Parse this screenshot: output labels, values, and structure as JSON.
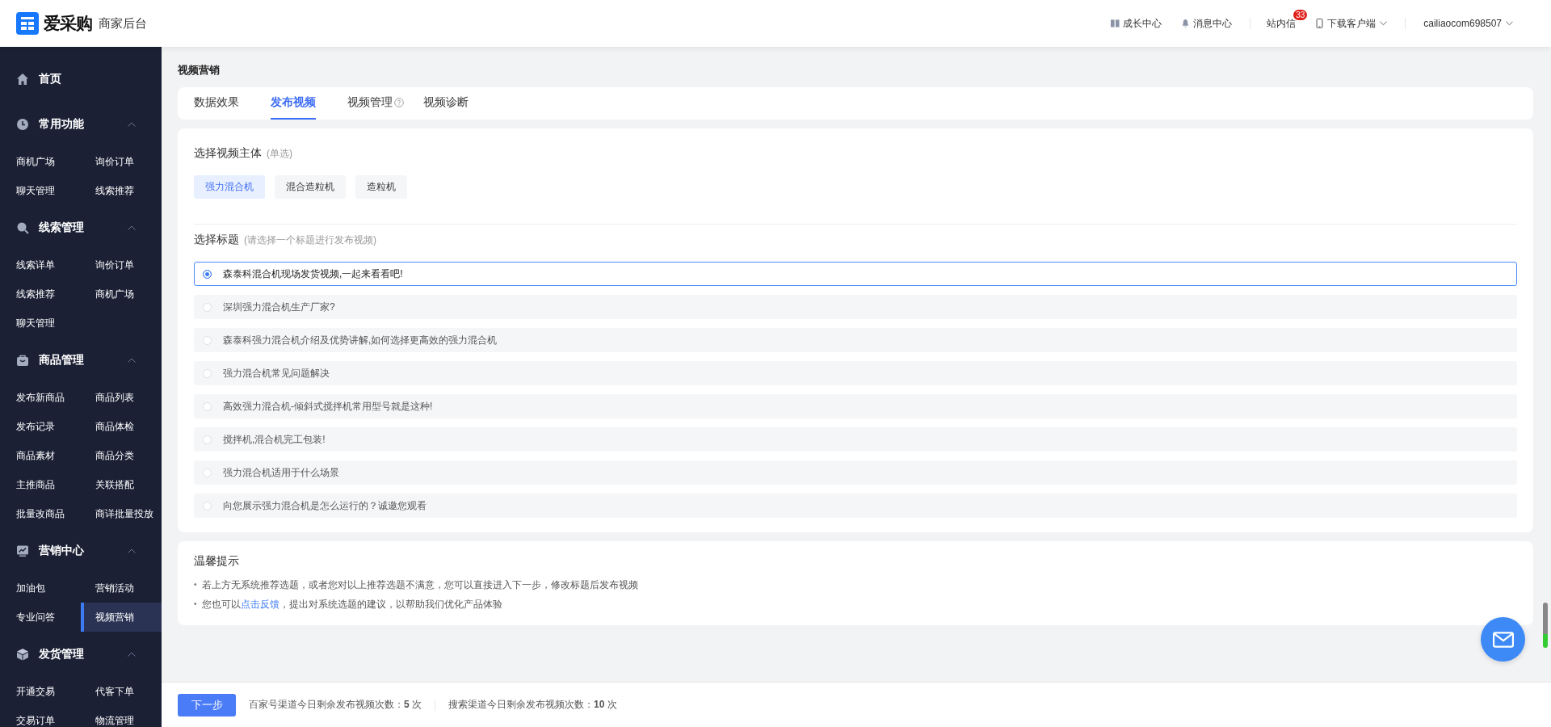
{
  "header": {
    "logo_text": "爱采购",
    "subtitle": "商家后台",
    "links": [
      {
        "kind": "growth",
        "label": "成长中心"
      },
      {
        "kind": "bell",
        "label": "消息中心"
      },
      {
        "kind": "inbox",
        "label": "站内信",
        "badge": "33"
      },
      {
        "kind": "download",
        "label": "下载客户端"
      },
      {
        "kind": "user",
        "label": "cailiaocom698507"
      }
    ]
  },
  "sidebar": {
    "sections": [
      {
        "title": "首页"
      },
      {
        "title": "常用功能",
        "expanded": true,
        "items": [
          {
            "label": "商机广场",
            "selected": false
          },
          {
            "label": "询价订单",
            "selected": false
          },
          {
            "label": "聊天管理",
            "selected": false
          },
          {
            "label": "线索推荐",
            "selected": false
          }
        ]
      },
      {
        "title": "线索管理",
        "expanded": true,
        "items": [
          {
            "label": "线索详单",
            "selected": false
          },
          {
            "label": "询价订单",
            "selected": false
          },
          {
            "label": "线索推荐",
            "selected": false
          },
          {
            "label": "商机广场",
            "selected": false
          },
          {
            "label": "聊天管理",
            "selected": false
          }
        ]
      },
      {
        "title": "商品管理",
        "expanded": true,
        "items": [
          {
            "label": "发布新商品",
            "selected": false
          },
          {
            "label": "商品列表",
            "selected": false
          },
          {
            "label": "发布记录",
            "selected": false
          },
          {
            "label": "商品体检",
            "selected": false
          },
          {
            "label": "商品素材",
            "selected": false
          },
          {
            "label": "商品分类",
            "selected": false
          },
          {
            "label": "主推商品",
            "selected": false
          },
          {
            "label": "关联搭配",
            "selected": false
          },
          {
            "label": "批量改商品",
            "selected": false
          },
          {
            "label": "商详批量投放",
            "selected": false
          }
        ]
      },
      {
        "title": "营销中心",
        "expanded": true,
        "items": [
          {
            "label": "加油包",
            "selected": false
          },
          {
            "label": "营销活动",
            "selected": false
          },
          {
            "label": "专业问答",
            "selected": false
          },
          {
            "label": "视频营销",
            "selected": true
          }
        ]
      },
      {
        "title": "发货管理",
        "expanded": true,
        "items": [
          {
            "label": "开通交易",
            "selected": false
          },
          {
            "label": "代客下单",
            "selected": false
          },
          {
            "label": "交易订单",
            "selected": false
          },
          {
            "label": "物流管理",
            "selected": false
          }
        ]
      }
    ]
  },
  "page_title": "视频营销",
  "tabs": [
    {
      "label": "数据效果",
      "selected": false
    },
    {
      "label": "发布视频",
      "selected": true
    },
    {
      "label": "视频管理",
      "selected": false,
      "help": true
    },
    {
      "label": "视频诊断",
      "selected": false
    }
  ],
  "subject": {
    "label": "选择视频主体",
    "hint": "(单选)",
    "options": [
      {
        "label": "强力混合机",
        "selected": true
      },
      {
        "label": "混合造粒机",
        "selected": false
      },
      {
        "label": "造粒机",
        "selected": false
      }
    ]
  },
  "titles": {
    "label": "选择标题",
    "hint": "(请选择一个标题进行发布视频)",
    "options": [
      {
        "label": "森泰科混合机现场发货视频,一起来看看吧!",
        "selected": true
      },
      {
        "label": "深圳强力混合机生产厂家?",
        "selected": false
      },
      {
        "label": "森泰科强力混合机介绍及优势讲解,如何选择更高效的强力混合机",
        "selected": false
      },
      {
        "label": "强力混合机常见问题解决",
        "selected": false
      },
      {
        "label": "高效强力混合机-倾斜式搅拌机常用型号就是这种!",
        "selected": false
      },
      {
        "label": "搅拌机,混合机完工包装!",
        "selected": false
      },
      {
        "label": "强力混合机适用于什么场景",
        "selected": false
      },
      {
        "label": "向您展示强力混合机是怎么运行的？诚邀您观看",
        "selected": false
      }
    ]
  },
  "tips": {
    "title": "温馨提示",
    "items": [
      {
        "marker": "•",
        "text": "若上方无系统推荐选题，或者您对以上推荐选题不满意，您可以直接进入下一步，修改标题后发布视频"
      },
      {
        "marker": "•",
        "text": "您也可以",
        "link": "点击反馈",
        "after": "，提出对系统选题的建议，以帮助我们优化产品体验"
      }
    ]
  },
  "footer": {
    "button": "下一步",
    "quotas": [
      "百家号渠道今日剩余发布视频次数：**5** 次",
      "搜索渠道今日剩余发布视频次数：**10** 次"
    ]
  }
}
